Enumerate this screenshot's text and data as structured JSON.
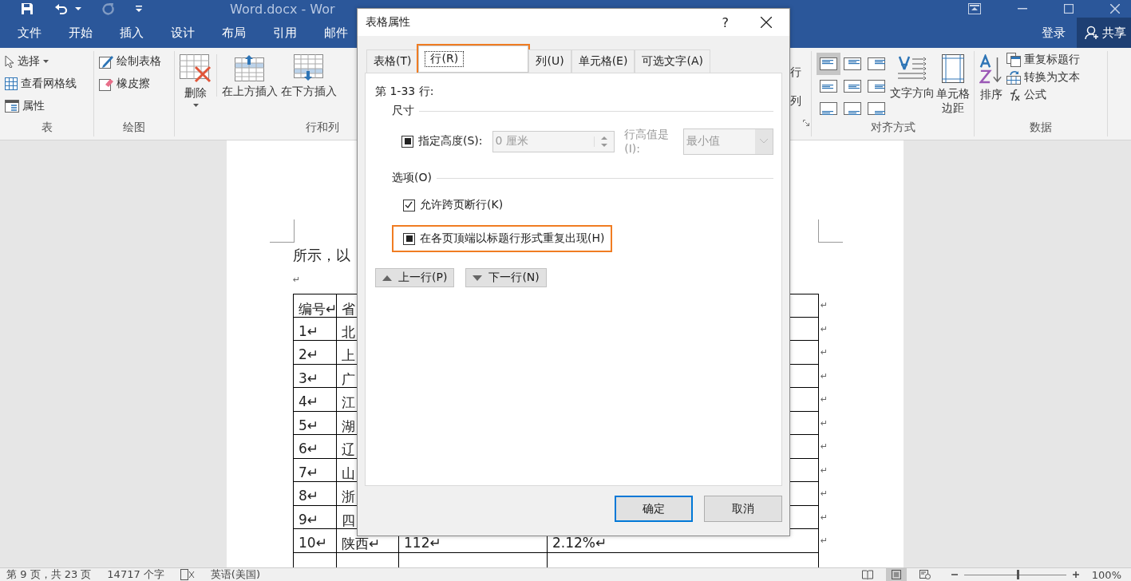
{
  "title_bar": {
    "title": "Word.docx - Wor",
    "redo_enabled": false
  },
  "menu_tabs": [
    "文件",
    "开始",
    "插入",
    "设计",
    "布局",
    "引用",
    "邮件"
  ],
  "account": {
    "sign_in": "登录",
    "share": "共享"
  },
  "ribbon_left": [
    {
      "label": "表",
      "items": [
        {
          "label": "选择",
          "has_menu": true
        },
        {
          "label": "查看网格线",
          "has_menu": false
        },
        {
          "label": "属性",
          "has_menu": false
        }
      ]
    },
    {
      "label": "绘图",
      "items": [
        {
          "label": "绘制表格",
          "has_menu": false
        },
        {
          "label": "橡皮擦",
          "has_menu": false
        }
      ]
    },
    {
      "label": "行和列",
      "items": [
        {
          "label": "删除",
          "has_menu": true
        },
        {
          "label": "在上方插入",
          "has_menu": false
        },
        {
          "label": "在下方插入",
          "has_menu": false
        }
      ]
    }
  ],
  "ribbon_right": {
    "cut_labels": [
      "行",
      "列"
    ],
    "alignment": {
      "label": "对齐方式",
      "cells": [
        {
          "selected": true
        },
        {
          "selected": false
        },
        {
          "selected": false
        },
        {
          "selected": false
        },
        {
          "selected": false
        },
        {
          "selected": false
        },
        {
          "selected": false
        },
        {
          "selected": false
        },
        {
          "selected": false
        }
      ],
      "items": [
        "文字方向",
        "单元格边距"
      ]
    },
    "data": {
      "label": "数据",
      "items": [
        "排序",
        "重复标题行",
        "转换为文本",
        "公式"
      ]
    }
  },
  "document": {
    "paragraph": "所示，以",
    "blank_mark": "↵",
    "table": {
      "rows": [
        {
          "cells": [
            "编号↵",
            "省"
          ],
          "end": "↵"
        },
        {
          "cells": [
            "1↵",
            "北"
          ],
          "end": "↵"
        },
        {
          "cells": [
            "2↵",
            "上"
          ],
          "end": "↵"
        },
        {
          "cells": [
            "3↵",
            "广"
          ],
          "end": "↵"
        },
        {
          "cells": [
            "4↵",
            "江"
          ],
          "end": "↵"
        },
        {
          "cells": [
            "5↵",
            "湖"
          ],
          "end": "↵"
        },
        {
          "cells": [
            "6↵",
            "辽"
          ],
          "end": "↵"
        },
        {
          "cells": [
            "7↵",
            "山"
          ],
          "end": "↵"
        },
        {
          "cells": [
            "8↵",
            "浙"
          ],
          "end": "↵"
        },
        {
          "cells": [
            "9↵",
            "四"
          ],
          "end": "↵"
        },
        {
          "cells": [
            "10↵",
            "陕西↵",
            "112↵",
            "2.12%↵"
          ],
          "end": "↵"
        }
      ]
    }
  },
  "dialog": {
    "title": "表格属性",
    "help": "?",
    "tabs": [
      {
        "label": "表格(T)",
        "selected": false,
        "highlighted": false
      },
      {
        "label": "行(R)",
        "selected": true,
        "highlighted": true
      },
      {
        "label": "列(U)",
        "selected": false,
        "highlighted": false
      },
      {
        "label": "单元格(E)",
        "selected": false,
        "highlighted": false
      },
      {
        "label": "可选文字(A)",
        "selected": false,
        "highlighted": false
      }
    ],
    "rows_heading": "第 1-33 行:",
    "size_section": {
      "title": "尺寸",
      "height_checkbox": {
        "label": "指定高度(S):",
        "checked": false,
        "indeterminate": true
      },
      "height_field": {
        "value": "0 厘米",
        "disabled": true
      },
      "rule_label": "行高值是(I):",
      "rule_select": {
        "value": "最小值",
        "disabled": true
      }
    },
    "options_section": {
      "title": "选项(O)",
      "checkboxes": [
        {
          "label": "允许跨页断行(K)",
          "checked": true,
          "indeterminate": false,
          "highlighted": false
        },
        {
          "label": "在各页顶端以标题行形式重复出现(H)",
          "checked": false,
          "indeterminate": true,
          "highlighted": true
        }
      ]
    },
    "nav_buttons": [
      {
        "label": "上一行(P)",
        "kind": "up"
      },
      {
        "label": "下一行(N)",
        "kind": "down"
      }
    ],
    "footer_buttons": [
      {
        "label": "确定",
        "default": true
      },
      {
        "label": "取消",
        "default": false
      }
    ]
  },
  "status_bar": {
    "page": "第 9 页，共 23 页",
    "words": "14717 个字",
    "language": "英语(美国)",
    "view_modes": [
      {
        "selected": false
      },
      {
        "selected": true
      },
      {
        "selected": false
      }
    ],
    "zoom": {
      "level": 0.53,
      "reading": "100%"
    }
  }
}
